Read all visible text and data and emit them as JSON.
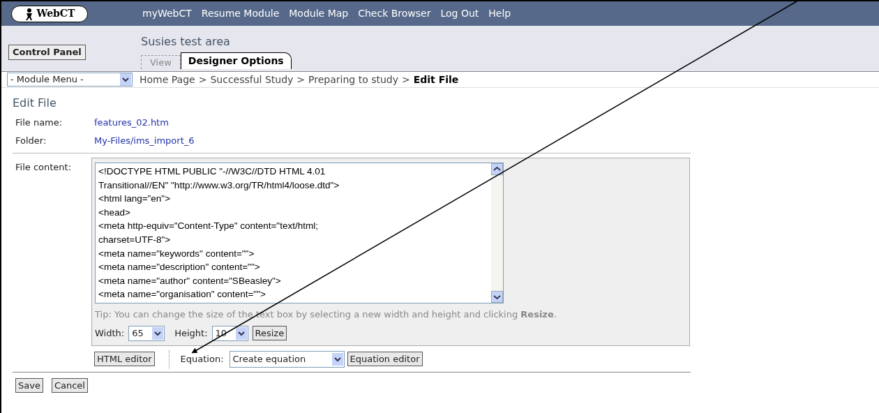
{
  "header": {
    "logo": "WebCT",
    "nav": [
      "myWebCT",
      "Resume Module",
      "Module Map",
      "Check Browser",
      "Log Out",
      "Help"
    ]
  },
  "control_panel": "Control Panel",
  "area_title": "Susies test area",
  "tabs": [
    {
      "label": "View",
      "selected": false
    },
    {
      "label": "Designer Options",
      "selected": true
    }
  ],
  "module_menu": {
    "value": "- Module Menu -"
  },
  "breadcrumb": [
    {
      "label": "Home Page",
      "current": false
    },
    {
      "label": "Successful Study",
      "current": false
    },
    {
      "label": "Preparing to study",
      "current": false
    },
    {
      "label": "Edit File",
      "current": true
    }
  ],
  "breadcrumb_separator": ">",
  "page_title": "Edit File",
  "fields": [
    {
      "label": "File name:",
      "value": "features_02.htm"
    },
    {
      "label": "Folder:",
      "value": "My-Files/ims_import_6"
    }
  ],
  "content_label": "File content:",
  "file_content": [
    "<!DOCTYPE HTML PUBLIC \"-//W3C//DTD HTML 4.01",
    "Transitional//EN\" \"http://www.w3.org/TR/html4/loose.dtd\">",
    "<html lang=\"en\">",
    "<head>",
    "<meta http-equiv=\"Content-Type\" content=\"text/html;",
    "charset=UTF-8\">",
    "<meta name=\"keywords\" content=\"\">",
    "<meta name=\"description\" content=\"\">",
    "<meta name=\"author\" content=\"SBeasley\">",
    "<meta name=\"organisation\" content=\"\">"
  ],
  "tip": "Tip: You can change the size of the text box by selecting a new width and height and clicking **Resize**.",
  "width": {
    "label": "Width:",
    "value": "65"
  },
  "height": {
    "label": "Height:",
    "value": "10"
  },
  "resize_button": "Resize",
  "html_editor_button": "HTML editor",
  "equation": {
    "label": "Equation:",
    "value": "Create equation",
    "button": "Equation editor"
  },
  "actions": [
    "Save",
    "Cancel"
  ]
}
